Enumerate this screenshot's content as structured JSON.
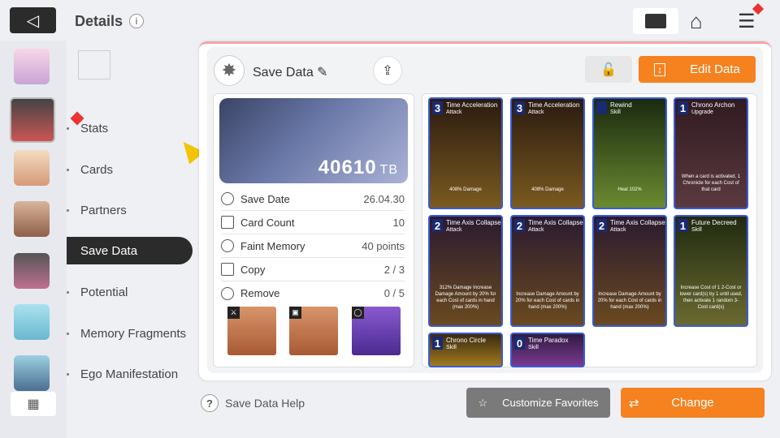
{
  "header": {
    "title": "Details",
    "info": "i",
    "back": "◁"
  },
  "menu": [
    {
      "label": "Stats"
    },
    {
      "label": "Cards"
    },
    {
      "label": "Partners"
    },
    {
      "label": "Save Data"
    },
    {
      "label": "Potential"
    },
    {
      "label": "Memory Fragments"
    },
    {
      "label": "Ego Manifestation"
    }
  ],
  "savedata": {
    "title": "Save Data",
    "amount": "40610",
    "unit": "TB",
    "edit_label": "Edit Data",
    "help": "Save Data Help"
  },
  "stats": [
    {
      "label": "Save Date",
      "value": "26.04.30"
    },
    {
      "label": "Card Count",
      "value": "10"
    },
    {
      "label": "Faint Memory",
      "value": "40 points"
    },
    {
      "label": "Copy",
      "value": "2 / 3"
    },
    {
      "label": "Remove",
      "value": "0 / 5"
    }
  ],
  "cards": [
    {
      "cost": "3",
      "name": "Time Acceleration",
      "type": "Attack",
      "desc": "408% Damage"
    },
    {
      "cost": "3",
      "name": "Time Acceleration",
      "type": "Attack",
      "desc": "408% Damage"
    },
    {
      "cost": "",
      "name": "Rewind",
      "type": "Skill",
      "desc": "Heal 102%"
    },
    {
      "cost": "1",
      "name": "Chrono Archon",
      "type": "Upgrade",
      "desc": "When a card is activated, 1 Chronicle for each Cost of that card"
    },
    {
      "cost": "2",
      "name": "Time Axis Collapse",
      "type": "Attack",
      "desc": "312% Damage Increase Damage Amount by 20% for each Cost of cards in hand (max 200%)"
    },
    {
      "cost": "2",
      "name": "Time Axis Collapse",
      "type": "Attack",
      "desc": "Increase Damage Amount by 20% for each Cost of cards in hand (max 200%)"
    },
    {
      "cost": "2",
      "name": "Time Axis Collapse",
      "type": "Attack",
      "desc": "Increase Damage Amount by 20% for each Cost of cards in hand (max 200%)"
    },
    {
      "cost": "1",
      "name": "Future Decreed",
      "type": "Skill",
      "desc": "Increase Cost of 1 2-Cost or lower card(s) by 1 until used, then activate 1 random 3-Cost card(s)"
    },
    {
      "cost": "1",
      "name": "Chrono Circle",
      "type": "Skill",
      "desc": ""
    },
    {
      "cost": "0",
      "name": "Time Paradox",
      "type": "Skill",
      "desc": ""
    }
  ],
  "buttons": {
    "customize": "Customize Favorites",
    "change": "Change"
  },
  "colors": {
    "accent": "#f5821f",
    "card_border": "#3a5bd6"
  }
}
